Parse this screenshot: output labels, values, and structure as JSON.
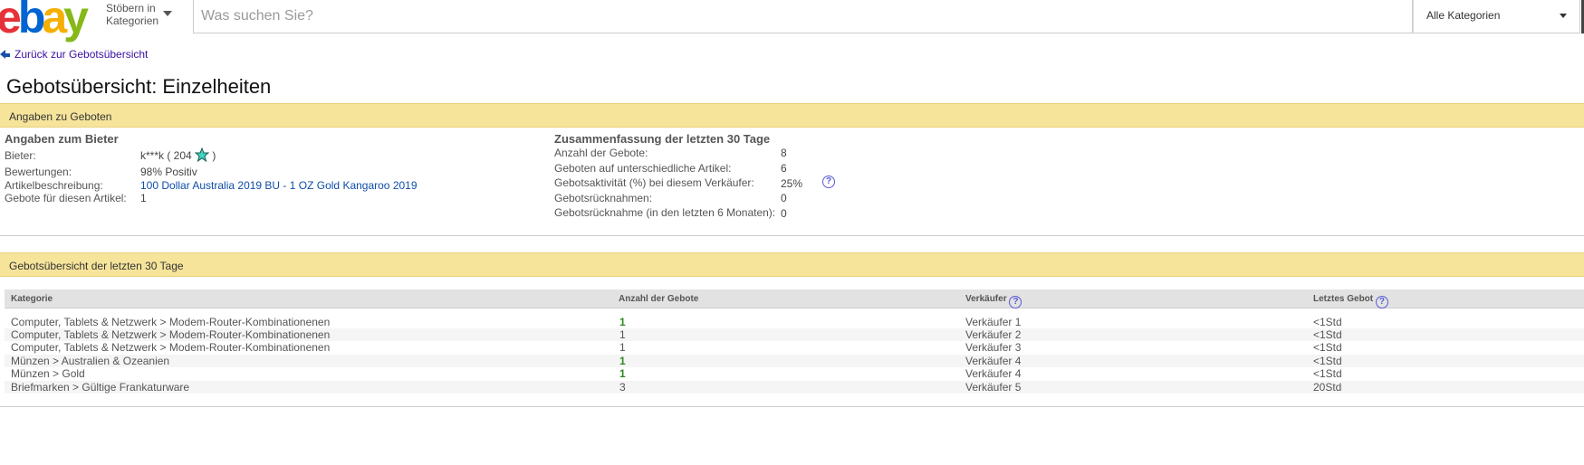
{
  "header": {
    "logo": {
      "e": "e",
      "b": "b",
      "a": "a",
      "y": "y"
    },
    "browse_line1": "Stöbern in",
    "browse_line2": "Kategorien",
    "search_placeholder": "Was suchen Sie?",
    "category_select": "Alle Kategorien"
  },
  "back_link": "Zurück zur Gebotsübersicht",
  "page_title": "Gebotsübersicht: Einzelheiten",
  "section1": {
    "title": "Angaben zu Geboten",
    "bidder": {
      "heading": "Angaben zum Bieter",
      "bidder_label": "Bieter:",
      "bidder_value": "k***k ( 204",
      "bidder_close": ")",
      "ratings_label": "Bewertungen:",
      "ratings_value": "98% Positiv",
      "item_label": "Artikelbeschreibung:",
      "item_value": "100 Dollar Australia 2019 BU - 1 OZ Gold Kangaroo 2019",
      "bids_label": "Gebote für diesen Artikel:",
      "bids_value": "1"
    },
    "summary": {
      "heading": "Zusammenfassung der letzten 30 Tage",
      "rows": [
        {
          "label": "Anzahl der Gebote:",
          "value": "8"
        },
        {
          "label": "Geboten auf unterschiedliche Artikel:",
          "value": "6"
        },
        {
          "label": "Gebotsaktivität (%) bei diesem Verkäufer:",
          "value": "25%"
        },
        {
          "label": "Gebotsrücknahmen:",
          "value": "0"
        },
        {
          "label": "Gebotsrücknahme (in den letzten 6 Monaten):",
          "value": "0"
        }
      ]
    }
  },
  "section2": {
    "title": "Gebotsübersicht der letzten 30 Tage",
    "columns": [
      "Kategorie",
      "Anzahl der Gebote",
      "Verkäufer",
      "Letztes Gebot"
    ],
    "rows": [
      {
        "category": "Computer, Tablets & Netzwerk > Modem-Router-Kombinationenen",
        "bids": "1",
        "seller": "Verkäufer 1",
        "last": "<1Std"
      },
      {
        "category": "Computer, Tablets & Netzwerk > Modem-Router-Kombinationenen",
        "bids": "1",
        "seller": "Verkäufer 2",
        "last": "<1Std"
      },
      {
        "category": "Computer, Tablets & Netzwerk > Modem-Router-Kombinationenen",
        "bids": "1",
        "seller": "Verkäufer 3",
        "last": "<1Std"
      },
      {
        "category": "Münzen > Australien & Ozeanien",
        "bids": "1",
        "seller": "Verkäufer 4",
        "last": "<1Std"
      },
      {
        "category": "Münzen > Gold",
        "bids": "1",
        "seller": "Verkäufer 4",
        "last": "<1Std"
      },
      {
        "category": "Briefmarken > Gültige Frankaturware",
        "bids": "3",
        "seller": "Verkäufer 5",
        "last": "20Std"
      }
    ]
  },
  "help_icon_glyph": "?",
  "colors": {
    "section_bar": "#f6e49b",
    "link": "#0e4ea8",
    "bid_green": "#2c8a1e"
  }
}
